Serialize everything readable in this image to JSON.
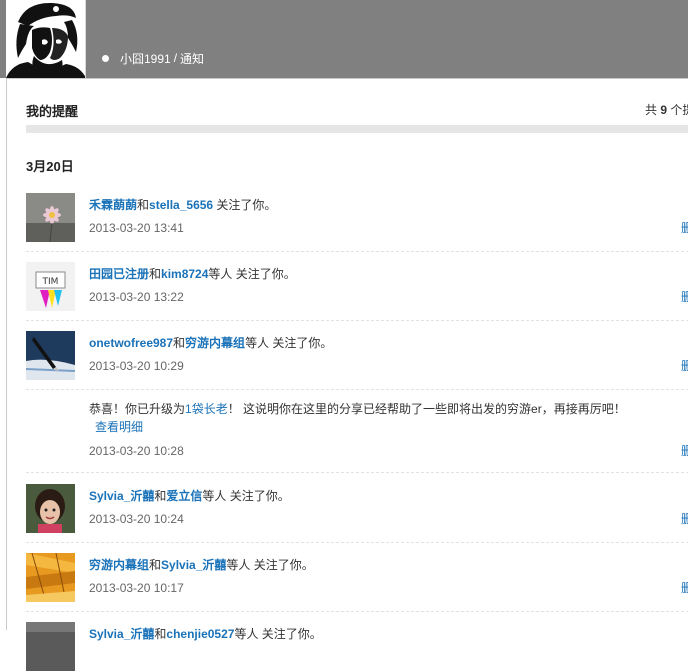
{
  "header": {
    "crumb_user": "小囧1991",
    "crumb_sep": "/",
    "crumb_page": "通知"
  },
  "panel": {
    "title": "我的提醒",
    "count_prefix": "共",
    "count_value": "9",
    "count_suffix": "个提"
  },
  "group": {
    "date": "3月20日"
  },
  "notifications": [
    {
      "users": [
        "禾霖蓢蓢",
        "stella_5656"
      ],
      "joiner": "和",
      "extra": "",
      "action": " 关注了你。",
      "time": "2013-03-20 13:41",
      "delete_label": "删"
    },
    {
      "users": [
        "田园已注册",
        "kim8724"
      ],
      "joiner": "和",
      "extra": "等人",
      "action": " 关注了你。",
      "time": "2013-03-20 13:22",
      "delete_label": "删"
    },
    {
      "users": [
        "onetwofree987",
        "穷游内幕组"
      ],
      "joiner": "和",
      "extra": "等人",
      "action": " 关注了你。",
      "time": "2013-03-20 10:29",
      "delete_label": "删"
    },
    {
      "system_text_a": "恭喜！你已升级为",
      "system_link": "1袋长老",
      "system_text_b": "！ 这说明你在这里的分享已经帮助了一些即将出发的穷游er，再接再厉吧！",
      "detail_link": "查看明细",
      "time": "2013-03-20 10:28",
      "delete_label": "删"
    },
    {
      "users": [
        "Sylvia_沂囍",
        "爱立信"
      ],
      "joiner": "和",
      "extra": "等人",
      "action": " 关注了你。",
      "time": "2013-03-20 10:24",
      "delete_label": "删"
    },
    {
      "users": [
        "穷游内幕组",
        "Sylvia_沂囍"
      ],
      "joiner": "和",
      "extra": "等人",
      "action": " 关注了你。",
      "time": "2013-03-20 10:17",
      "delete_label": "删"
    },
    {
      "users": [
        "Sylvia_沂囍",
        "chenjie0527"
      ],
      "joiner": "和",
      "extra": "等人",
      "action": " 关注了你。"
    }
  ]
}
